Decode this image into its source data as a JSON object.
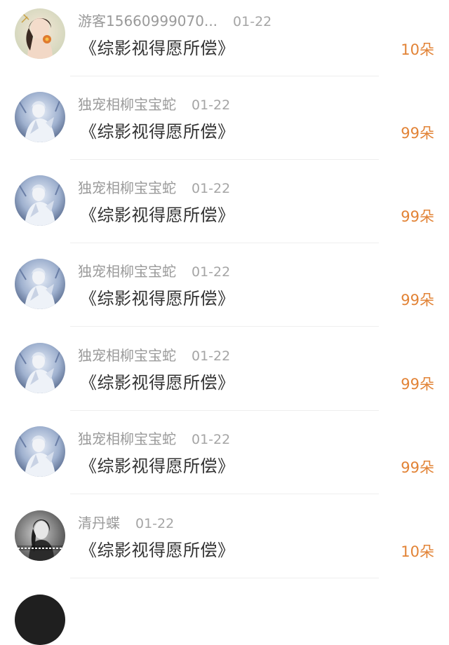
{
  "gifts": [
    {
      "name": "游客15660999070...",
      "time": "01-22",
      "title": "《综影视得愿所偿》",
      "amount": "10朵",
      "avatar": "woman-with-flower-avatar"
    },
    {
      "name": "独宠相柳宝宝蛇",
      "time": "01-22",
      "title": "《综影视得愿所偿》",
      "amount": "99朵",
      "avatar": "white-robed-figure-avatar"
    },
    {
      "name": "独宠相柳宝宝蛇",
      "time": "01-22",
      "title": "《综影视得愿所偿》",
      "amount": "99朵",
      "avatar": "white-robed-figure-avatar"
    },
    {
      "name": "独宠相柳宝宝蛇",
      "time": "01-22",
      "title": "《综影视得愿所偿》",
      "amount": "99朵",
      "avatar": "white-robed-figure-avatar"
    },
    {
      "name": "独宠相柳宝宝蛇",
      "time": "01-22",
      "title": "《综影视得愿所偿》",
      "amount": "99朵",
      "avatar": "white-robed-figure-avatar"
    },
    {
      "name": "独宠相柳宝宝蛇",
      "time": "01-22",
      "title": "《综影视得愿所偿》",
      "amount": "99朵",
      "avatar": "white-robed-figure-avatar"
    },
    {
      "name": "清丹蝶",
      "time": "01-22",
      "title": "《综影视得愿所偿》",
      "amount": "10朵",
      "avatar": "black-white-portrait-avatar"
    }
  ],
  "colors": {
    "amount": "#e28336",
    "name": "#9a9a9a",
    "title": "#333333",
    "divider": "#eeeeee"
  }
}
